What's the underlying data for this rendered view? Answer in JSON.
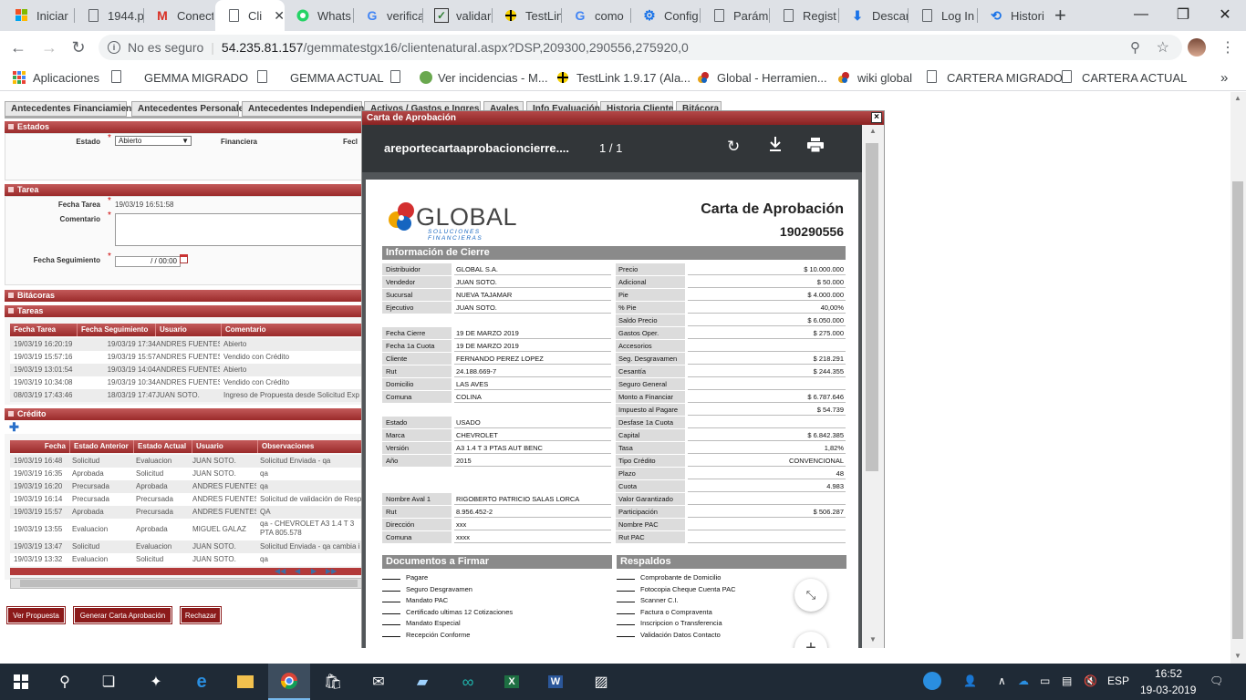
{
  "browser": {
    "tabs": [
      {
        "label": "Iniciar",
        "icon": "windows-icon"
      },
      {
        "label": "1944.p",
        "icon": "document-icon"
      },
      {
        "label": "Conect",
        "icon": "gmail-icon"
      },
      {
        "label": "Cli",
        "icon": "document-icon",
        "active": true
      },
      {
        "label": "Whats",
        "icon": "whatsapp-icon"
      },
      {
        "label": "verifica",
        "icon": "google-icon"
      },
      {
        "label": "validar",
        "icon": "checkbox-icon"
      },
      {
        "label": "TestLin",
        "icon": "testlink-icon"
      },
      {
        "label": "como",
        "icon": "google-icon"
      },
      {
        "label": "Config",
        "icon": "gear-icon"
      },
      {
        "label": "Parám",
        "icon": "document-icon"
      },
      {
        "label": "Regist",
        "icon": "document-icon"
      },
      {
        "label": "Descar",
        "icon": "download-icon"
      },
      {
        "label": "Log In",
        "icon": "document-icon"
      },
      {
        "label": "Histori",
        "icon": "history-icon"
      }
    ],
    "security": "No es seguro",
    "url_host": "54.235.81.157",
    "url_path": "/gemmatestgx16/clientenatural.aspx?DSP,209300,290556,275920,0",
    "bookmarks": [
      {
        "label": "Aplicaciones",
        "icon": "apps-grid-icon"
      },
      {
        "label": "GEMMA MIGRADO",
        "icon": "document-icon"
      },
      {
        "label": "GEMMA ACTUAL",
        "icon": "document-icon"
      },
      {
        "label": "Ver incidencias - M...",
        "icon": "bug-icon"
      },
      {
        "label": "TestLink 1.9.17 (Ala...",
        "icon": "testlink-icon"
      },
      {
        "label": "Global - Herramien...",
        "icon": "global-icon"
      },
      {
        "label": "wiki global",
        "icon": "global-icon"
      },
      {
        "label": "CARTERA MIGRADO",
        "icon": "document-icon"
      },
      {
        "label": "CARTERA ACTUAL",
        "icon": "document-icon"
      }
    ],
    "more": "»"
  },
  "page": {
    "tabs": [
      "Antecedentes Financiamiento",
      "Antecedentes Personales",
      "Antecedentes Independiente",
      "Activos / Gastos e Ingresos",
      "Avales",
      "Info Evaluación",
      "Historia Cliente",
      "Bitácora"
    ],
    "estados": {
      "title": "Estados",
      "estado_label": "Estado",
      "estado_value": "Abierto",
      "financiera_label": "Financiera",
      "fec_label": "Fecl"
    },
    "tarea": {
      "title": "Tarea",
      "fecha_tarea_label": "Fecha Tarea",
      "fecha_tarea_value": "19/03/19 16:51:58",
      "comentario_label": "Comentario",
      "fecha_seguimiento_label": "Fecha Seguimiento",
      "fecha_seguimiento_value": "/ /  00:00"
    },
    "bitacoras_title": "Bitácoras",
    "tareas": {
      "title": "Tareas",
      "columns": [
        "Fecha Tarea",
        "Fecha Seguimiento",
        "Usuario",
        "Comentario"
      ],
      "rows": [
        [
          "19/03/19 16:20:19",
          "19/03/19 17:34",
          "ANDRES FUENTES",
          "Abierto"
        ],
        [
          "19/03/19 15:57:16",
          "19/03/19 15:57",
          "ANDRES FUENTES",
          "Vendido con Crédito"
        ],
        [
          "19/03/19 13:01:54",
          "19/03/19 14:04",
          "ANDRES FUENTES",
          "Abierto"
        ],
        [
          "19/03/19 10:34:08",
          "19/03/19 10:34",
          "ANDRES FUENTES",
          "Vendido con Crédito"
        ],
        [
          "08/03/19 17:43:46",
          "18/03/19 17:47",
          "JUAN SOTO.",
          "Ingreso de Propuesta desde Solicitud Exp"
        ]
      ]
    },
    "credito": {
      "title": "Crédito",
      "columns": [
        "Fecha",
        "Estado Anterior",
        "Estado Actual",
        "Usuario",
        "Observaciones"
      ],
      "rows": [
        [
          "19/03/19 16:48",
          "Solicitud",
          "Evaluacion",
          "JUAN SOTO.",
          "Solicitud Enviada - qa"
        ],
        [
          "19/03/19 16:35",
          "Aprobada",
          "Solicitud",
          "JUAN SOTO.",
          "qa"
        ],
        [
          "19/03/19 16:20",
          "Precursada",
          "Aprobada",
          "ANDRES FUENTES",
          "qa"
        ],
        [
          "19/03/19 16:14",
          "Precursada",
          "Precursada",
          "ANDRES FUENTES",
          "Solicitud de validación de Resp"
        ],
        [
          "19/03/19 15:57",
          "Aprobada",
          "Precursada",
          "ANDRES FUENTES",
          "QA"
        ],
        [
          "19/03/19 13:55",
          "Evaluacion",
          "Aprobada",
          "MIGUEL GALAZ",
          "qa - CHEVROLET A3 1.4 T 3 PTA 805.578"
        ],
        [
          "19/03/19 13:47",
          "Solicitud",
          "Evaluacion",
          "JUAN SOTO.",
          "Solicitud Enviada - qa cambia i"
        ],
        [
          "19/03/19 13:32",
          "Evaluacion",
          "Solicitud",
          "JUAN SOTO.",
          "qa"
        ]
      ]
    },
    "buttons": {
      "ver_propuesta": "Ver Propuesta",
      "generar_carta": "Generar Carta Aprobación",
      "rechazar": "Rechazar"
    }
  },
  "modal": {
    "title": "Carta de Aprobación",
    "close": "×",
    "pdf_name": "areportecartaaprobacioncierre....",
    "page_count": "1 / 1",
    "logo_name": "GLOBAL",
    "logo_tagline": "SOLUCIONES FINANCIERAS",
    "doc_title": "Carta de Aprobación",
    "doc_number": "190290556",
    "info_header": "Información de Cierre",
    "left_group1": [
      {
        "label": "Distribuidor",
        "value": "GLOBAL S.A."
      },
      {
        "label": "Vendedor",
        "value": "JUAN SOTO."
      },
      {
        "label": "Sucursal",
        "value": "NUEVA TAJAMAR"
      },
      {
        "label": "Ejecutivo",
        "value": "JUAN SOTO."
      }
    ],
    "left_group2": [
      {
        "label": "Fecha Cierre",
        "value": "19 DE MARZO 2019"
      },
      {
        "label": "Fecha 1a Cuota",
        "value": "19 DE MARZO 2019"
      },
      {
        "label": "Cliente",
        "value": "FERNANDO PEREZ LOPEZ"
      },
      {
        "label": "Rut",
        "value": "24.188.669-7"
      },
      {
        "label": "Domicilio",
        "value": "LAS AVES"
      },
      {
        "label": "Comuna",
        "value": "COLINA"
      }
    ],
    "left_group3": [
      {
        "label": "Estado",
        "value": "USADO"
      },
      {
        "label": "Marca",
        "value": "CHEVROLET"
      },
      {
        "label": "Versión",
        "value": "A3 1.4 T 3 PTAS AUT BENC"
      },
      {
        "label": "Año",
        "value": "2015"
      }
    ],
    "left_group4": [
      {
        "label": "Nombre Aval 1",
        "value": "RIGOBERTO PATRICIO SALAS LORCA"
      },
      {
        "label": "Rut",
        "value": "8.956.452-2"
      },
      {
        "label": "Dirección",
        "value": "xxx"
      },
      {
        "label": "Comuna",
        "value": "xxxx"
      }
    ],
    "right_rows": [
      {
        "label": "Precio",
        "value": "$ 10.000.000"
      },
      {
        "label": "Adicional",
        "value": "$ 50.000"
      },
      {
        "label": "Pie",
        "value": "$ 4.000.000"
      },
      {
        "label": "% Pie",
        "value": "40,00%"
      },
      {
        "label": "Saldo Precio",
        "value": "$ 6.050.000"
      },
      {
        "label": "Gastos Oper.",
        "value": "$ 275.000"
      },
      {
        "label": "Accesorios",
        "value": ""
      },
      {
        "label": "Seg. Desgravamen",
        "value": "$ 218.291"
      },
      {
        "label": "Cesantía",
        "value": "$ 244.355"
      },
      {
        "label": "Seguro General",
        "value": ""
      },
      {
        "label": "Monto a Financiar",
        "value": "$ 6.787.646"
      },
      {
        "label": "Impuesto al Pagare",
        "value": "$ 54.739"
      },
      {
        "label": "Desfase 1a Cuota",
        "value": ""
      },
      {
        "label": "Capital",
        "value": "$ 6.842.385"
      },
      {
        "label": "Tasa",
        "value": "1,82%"
      },
      {
        "label": "Tipo Crédito",
        "value": "CONVENCIONAL"
      },
      {
        "label": "Plazo",
        "value": "48"
      },
      {
        "label": "Cuota",
        "value": "4.983"
      },
      {
        "label": "Valor Garantizado",
        "value": ""
      },
      {
        "label": "Participación",
        "value": "$ 506.287"
      },
      {
        "label": "Nombre PAC",
        "value": ""
      },
      {
        "label": "Rut PAC",
        "value": ""
      }
    ],
    "docs_header": "Documentos a Firmar",
    "docs": [
      "Pagare",
      "Seguro Desgravamen",
      "Mandato PAC",
      "Certificado ultimas 12 Cotizaciones",
      "Mandato Especial",
      "Recepción Conforme"
    ],
    "respaldos_header": "Respaldos",
    "respaldos": [
      "Comprobante de Domicilio",
      "Fotocopia Cheque Cuenta PAC",
      "Scanner C.I.",
      "Factura o Compraventa",
      "Inscripcion o Transferencia",
      "Validación Datos Contacto"
    ]
  },
  "taskbar": {
    "lang": "ESP",
    "time": "16:52",
    "date": "19-03-2019"
  }
}
